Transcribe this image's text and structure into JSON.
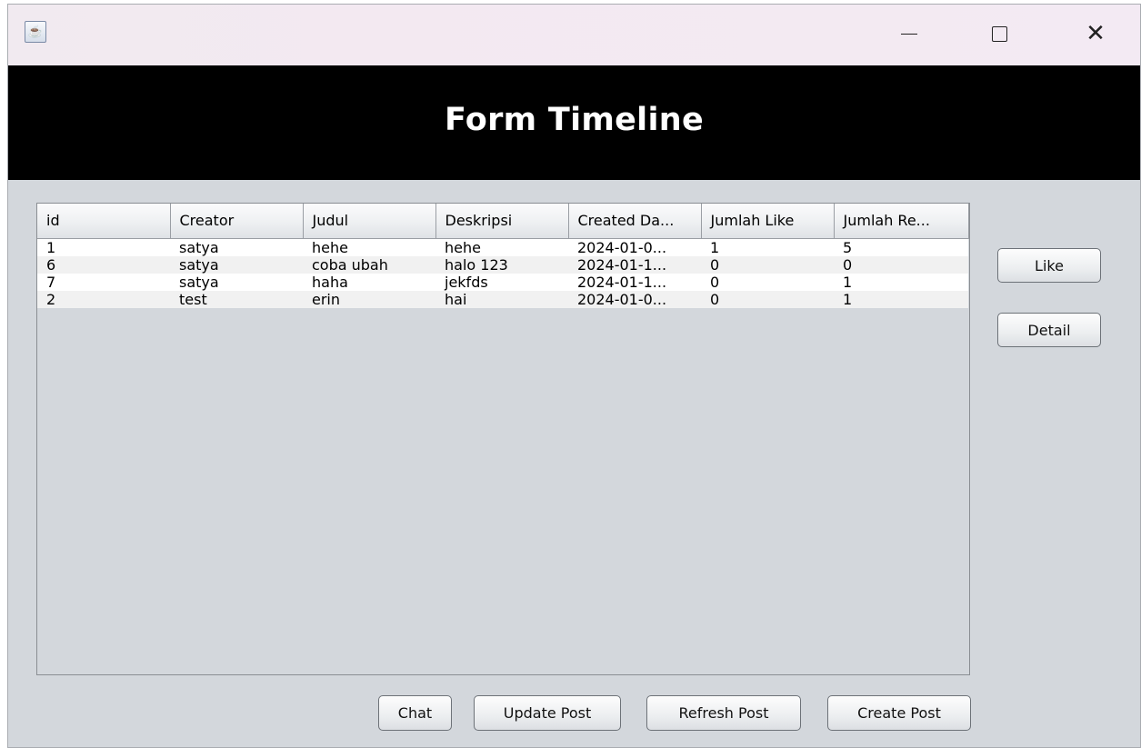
{
  "window": {
    "app_icon": "java-coffee-cup-icon",
    "controls": {
      "minimize_icon": "minimize-icon",
      "maximize_icon": "maximize-icon",
      "close_icon": "close-icon",
      "close_glyph": "✕"
    }
  },
  "header": {
    "title": "Form Timeline"
  },
  "table": {
    "columns": [
      "id",
      "Creator",
      "Judul",
      "Deskripsi",
      "Created Da...",
      "Jumlah Like",
      "Jumlah Re..."
    ],
    "rows": [
      [
        "1",
        "satya",
        "hehe",
        "hehe",
        "2024-01-0...",
        "1",
        "5"
      ],
      [
        "6",
        "satya",
        "coba ubah",
        "halo 123",
        "2024-01-1...",
        "0",
        "0"
      ],
      [
        "7",
        "satya",
        "haha",
        "jekfds",
        "2024-01-1...",
        "0",
        "1"
      ],
      [
        "2",
        "test",
        "erin",
        "hai",
        "2024-01-0...",
        "0",
        "1"
      ]
    ]
  },
  "side_actions": {
    "like_label": "Like",
    "detail_label": "Detail"
  },
  "bottom_actions": {
    "chat_label": "Chat",
    "update_label": "Update Post",
    "refresh_label": "Refresh Post",
    "create_label": "Create Post"
  }
}
